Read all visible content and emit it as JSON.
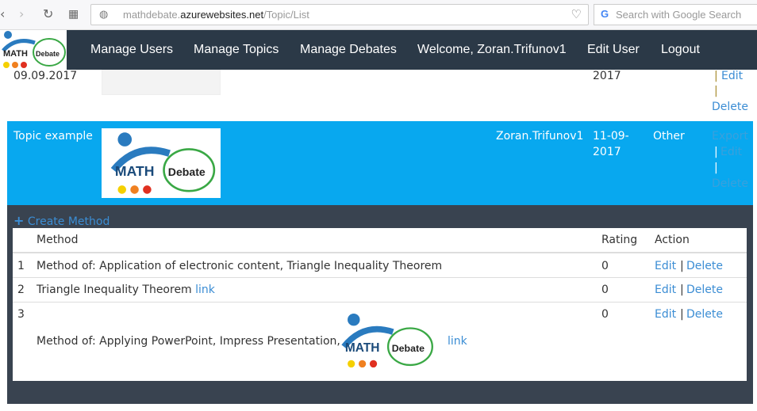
{
  "browser": {
    "url_host_prefix": "mathdebate.",
    "url_host": "azurewebsites.net",
    "url_path": "/Topic/List",
    "search_placeholder": "Search with Google Search"
  },
  "nav": {
    "items": [
      "Manage Users",
      "Manage Topics",
      "Manage Debates",
      "Welcome, Zoran.Trifunov1",
      "Edit User",
      "Logout"
    ]
  },
  "logo": {
    "text1": "MATH",
    "text2": "Debate"
  },
  "prev_row": {
    "date": "09.09.2017",
    "created": "2017",
    "edit": "Edit",
    "delete": "Delete",
    "sep": "|"
  },
  "topic_row": {
    "name": "Topic example",
    "author": "Zoran.Trifunov1",
    "date_line1": "11-09-",
    "date_line2": "2017",
    "category": "Other",
    "export": "Export",
    "edit": "Edit",
    "delete": "Delete",
    "sep": "|"
  },
  "methods": {
    "create_label": "Create Method",
    "headers": {
      "method": "Method",
      "rating": "Rating",
      "action": "Action"
    },
    "rows": [
      {
        "num": "1",
        "text": "Method of: Application of electronic content, Triangle Inequality Theorem",
        "link": "",
        "rating": "0",
        "edit": "Edit",
        "delete": "Delete"
      },
      {
        "num": "2",
        "text": "Triangle Inequality Theorem",
        "link": "link",
        "rating": "0",
        "edit": "Edit",
        "delete": "Delete"
      },
      {
        "num": "3",
        "text": "Method of: Applying PowerPoint, Impress Presentation,",
        "link": "link",
        "rating": "0",
        "edit": "Edit",
        "delete": "Delete"
      }
    ],
    "sep": "|"
  },
  "colors": {
    "nav": "#2b3947",
    "selected_row": "#08a8ef",
    "panel": "#394350",
    "link": "#3b8dd4"
  }
}
